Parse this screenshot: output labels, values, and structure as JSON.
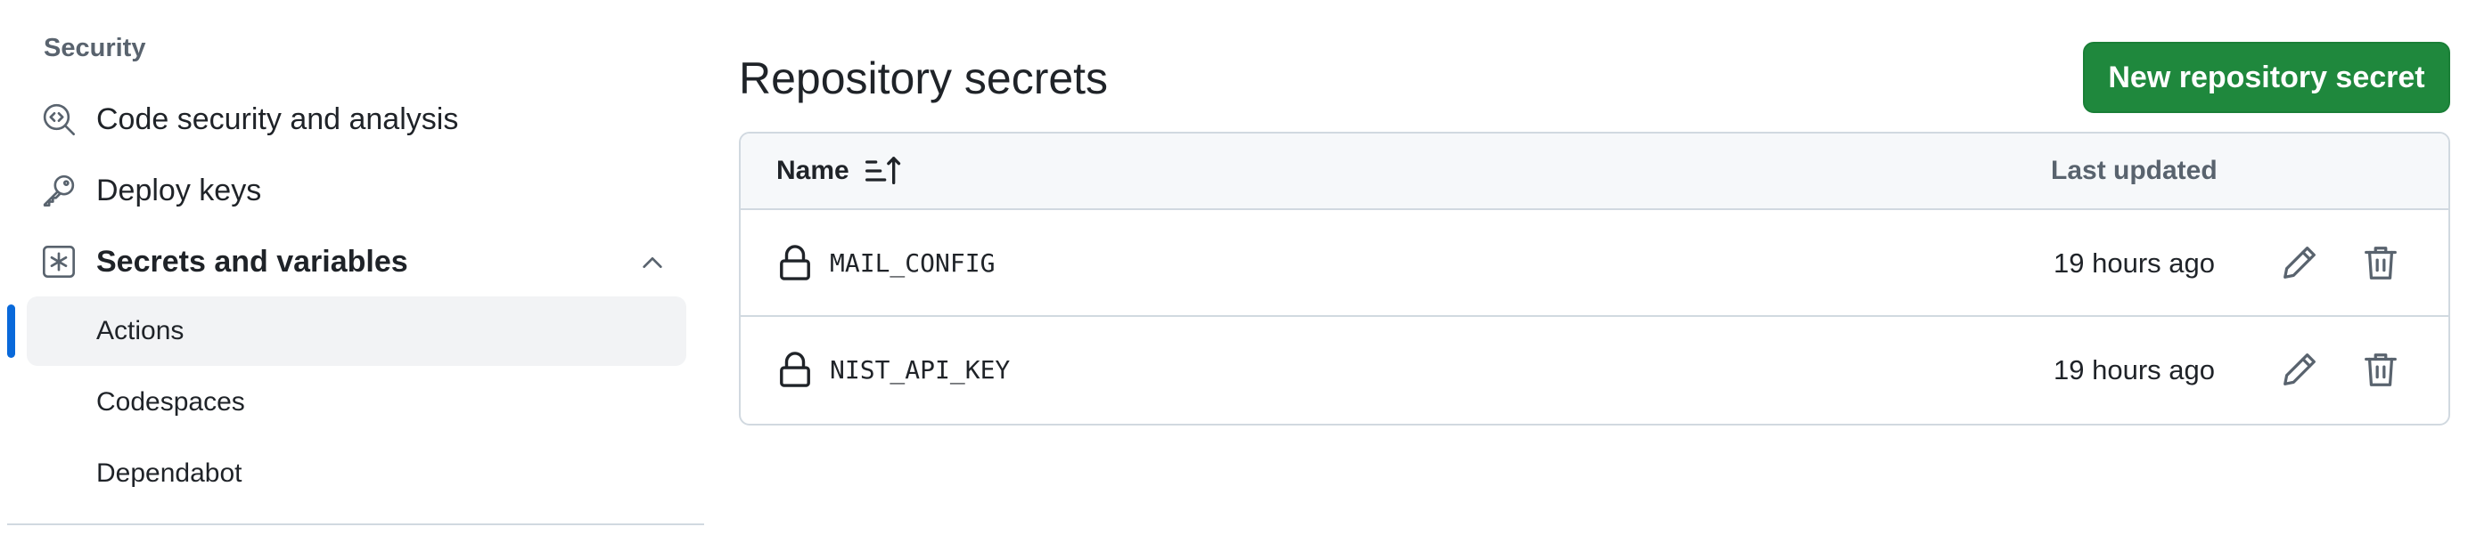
{
  "sidebar": {
    "section_heading": "Security",
    "items": [
      {
        "label": "Code security and analysis",
        "icon": "codescan-icon"
      },
      {
        "label": "Deploy keys",
        "icon": "key-icon"
      },
      {
        "label": "Secrets and variables",
        "icon": "asterisk-icon",
        "expanded": true
      }
    ],
    "sub_items": [
      {
        "label": "Actions",
        "active": true
      },
      {
        "label": "Codespaces",
        "active": false
      },
      {
        "label": "Dependabot",
        "active": false
      }
    ],
    "active_color": "#0969da"
  },
  "main": {
    "title": "Repository secrets",
    "new_button_label": "New repository secret",
    "button_color": "#1f883d",
    "table": {
      "columns": {
        "name": "Name",
        "last_updated": "Last updated"
      },
      "sort_icon": "sort-asc-icon",
      "rows": [
        {
          "name": "MAIL_CONFIG",
          "updated": "19 hours ago"
        },
        {
          "name": "NIST_API_KEY",
          "updated": "19 hours ago"
        }
      ]
    }
  }
}
